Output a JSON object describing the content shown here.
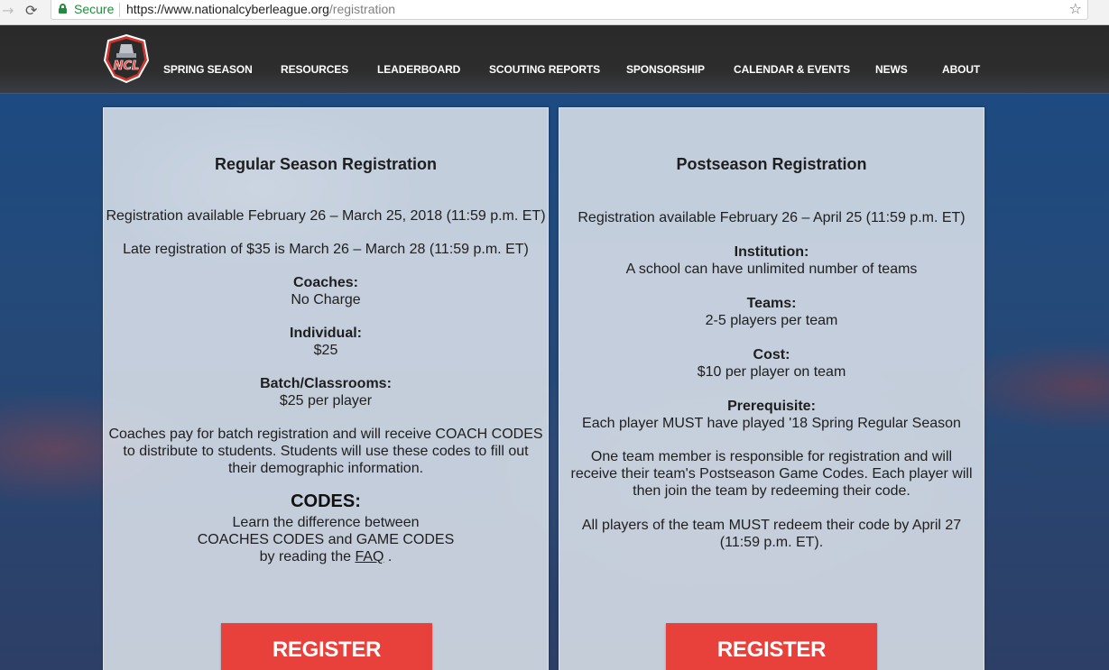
{
  "browser": {
    "secure_label": "Secure",
    "url_host": "https://www.nationalcyberleague.org",
    "url_path": "/registration"
  },
  "header": {
    "logo_text": "NCL",
    "nav": [
      "SPRING SEASON",
      "RESOURCES",
      "LEADERBOARD",
      "SCOUTING REPORTS",
      "SPONSORSHIP",
      "CALENDAR & EVENTS",
      "NEWS",
      "ABOUT"
    ]
  },
  "regular": {
    "title": "Regular Season Registration",
    "availability": "Registration available February 26 – March 25, 2018 (11:59 p.m. ET)",
    "late": "Late registration of $35 is March 26 – March 28 (11:59 p.m. ET)",
    "coaches_label": "Coaches:",
    "coaches_value": "No Charge",
    "individual_label": "Individual:",
    "individual_value": "$25",
    "batch_label": "Batch/Classrooms:",
    "batch_value": "$25 per player",
    "info": [
      "Coaches pay for batch registration and will receive COACH CODES",
      "to distribute to students. Students will use these codes to fill out",
      "their demographic information."
    ],
    "codes_heading": "CODES:",
    "codes_lines": [
      "Learn the difference between",
      "COACHES CODES and GAME CODES"
    ],
    "codes_by": "by reading the",
    "faq_link": "FAQ",
    "codes_end": " .",
    "register_label": "REGISTER"
  },
  "postseason": {
    "title": "Postseason Registration",
    "availability": "Registration available February 26 – April 25 (11:59 p.m. ET)",
    "institution_label": "Institution:",
    "institution_value": "A school can have unlimited number of teams",
    "teams_label": "Teams:",
    "teams_value": "2-5 players per team",
    "cost_label": "Cost:",
    "cost_value": "$10 per player on team",
    "prereq_label": "Prerequisite:",
    "prereq_value": "Each player MUST have played '18 Spring Regular Season",
    "info": [
      "One team member is responsible for registration and will",
      "receive their team's Postseason Game Codes. Each player will",
      "then join the team by redeeming their code."
    ],
    "redeem": [
      "All players of the team MUST redeem their code by April 27",
      "(11:59 p.m. ET)."
    ],
    "register_label": "REGISTER"
  }
}
